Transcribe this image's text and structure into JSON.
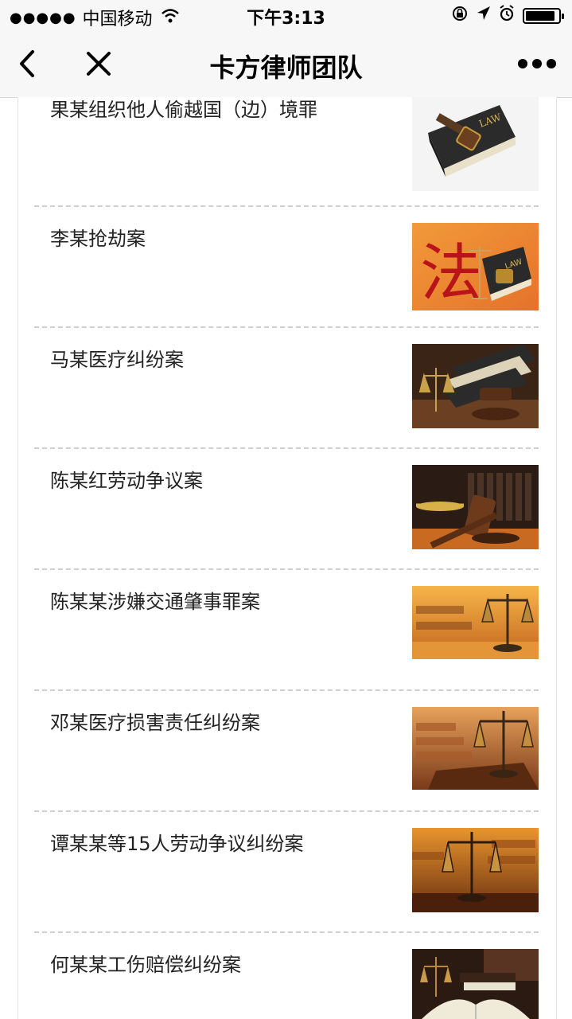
{
  "status_bar": {
    "signal": "●●●●●",
    "carrier": "中国移动",
    "time": "下午3:13",
    "battery_level": 0.9,
    "icons": [
      "wifi-icon",
      "orientation-lock-icon",
      "location-arrow-icon",
      "alarm-icon",
      "battery-icon"
    ]
  },
  "nav": {
    "title": "卡方律师团队",
    "icons": [
      "back-chevron-icon",
      "close-icon",
      "more-dots-icon"
    ]
  },
  "cases": [
    {
      "title": "果某组织他人偷越国（边）境罪",
      "thumb": "law-book-gavel-image"
    },
    {
      "title": "李某抢劫案",
      "thumb": "fa-calligraphy-law-book-image"
    },
    {
      "title": "马某医疗纠纷案",
      "thumb": "books-scales-gavel-image"
    },
    {
      "title": "陈某红劳动争议案",
      "thumb": "gavel-scales-bookshelf-image"
    },
    {
      "title": "陈某某涉嫌交通肇事罪案",
      "thumb": "scales-courtroom-image"
    },
    {
      "title": "邓某医疗损害责任纠纷案",
      "thumb": "scales-courtroom-image"
    },
    {
      "title": "谭某某等15人劳动争议纠纷案",
      "thumb": "scales-courtroom-image"
    },
    {
      "title": "何某某工伤赔偿纠纷案",
      "thumb": "scales-open-book-image"
    }
  ],
  "colors": {
    "divider": "#cfcfcf",
    "nav_bg": "#f7f7f7",
    "text": "#222222"
  }
}
